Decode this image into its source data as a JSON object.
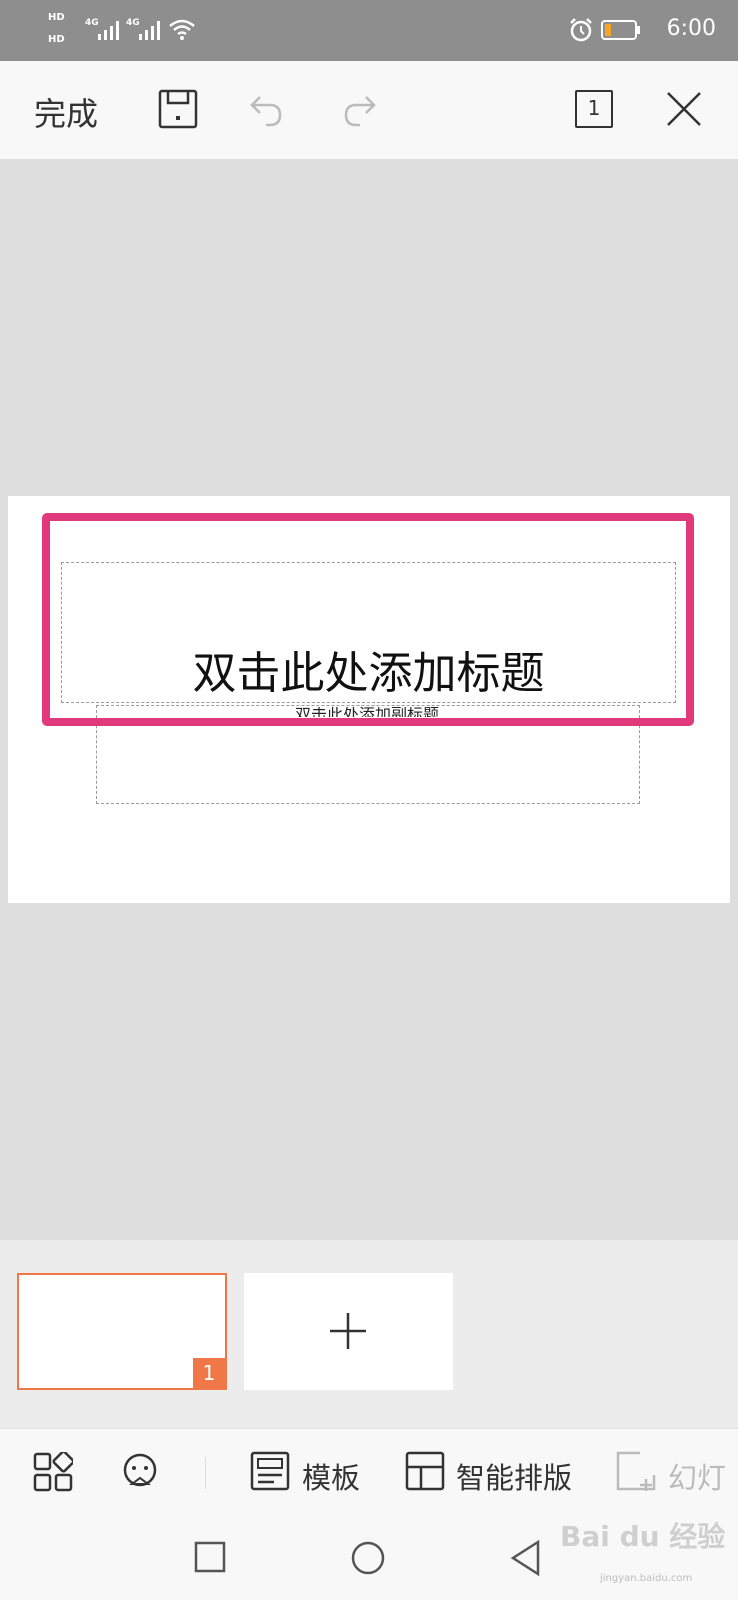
{
  "status_bar": {
    "time": "6:00",
    "hd1": "HD",
    "hd2": "HD",
    "net1": "4G",
    "net2": "4G",
    "icons": [
      "signal-icon",
      "wifi-icon",
      "alarm-icon",
      "battery-icon"
    ],
    "battery_color": "#f5a623"
  },
  "toolbar": {
    "done_label": "完成",
    "page_indicator": "1",
    "icons": [
      "save-icon",
      "undo-icon",
      "redo-icon",
      "page-count-icon",
      "close-icon"
    ]
  },
  "slide": {
    "title_placeholder": "双击此处添加标题",
    "subtitle_placeholder": "双击此处添加副标题",
    "highlight_color": "#e0397c"
  },
  "thumbnails": {
    "items": [
      {
        "number": "1",
        "selected": true
      }
    ],
    "add_icon": "plus-icon",
    "accent": "#f07848"
  },
  "bottom_toolbar": {
    "items": [
      {
        "icon": "grid-icon",
        "label": ""
      },
      {
        "icon": "face-icon",
        "label": ""
      },
      {
        "icon": "template-icon",
        "label": "模板"
      },
      {
        "icon": "layout-icon",
        "label": "智能排版"
      },
      {
        "icon": "new-slide-icon",
        "label": "幻灯"
      }
    ]
  },
  "nav_bar": {
    "icons": [
      "recent-apps-icon",
      "home-icon",
      "back-icon"
    ]
  },
  "watermark": {
    "text": "Bai du 经验",
    "sub": "jingyan.baidu.com"
  }
}
